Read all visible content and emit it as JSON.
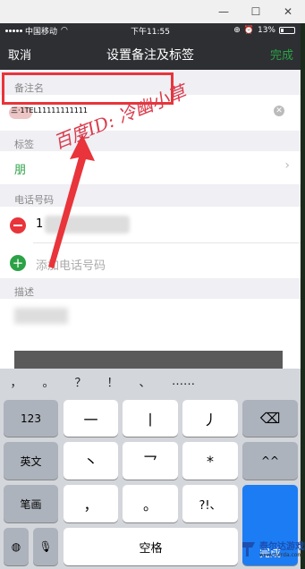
{
  "window": {
    "controls": [
      "—",
      "☐",
      "✕"
    ]
  },
  "status": {
    "carrier": "中国移动",
    "time": "下午11:55",
    "battery": "13%"
  },
  "nav": {
    "cancel": "取消",
    "title": "设置备注及标签",
    "done": "完成"
  },
  "remark": {
    "section_label": "备注名",
    "value": "三·1TEL11111111111"
  },
  "tags": {
    "section_label": "标签",
    "value": "朋"
  },
  "phone": {
    "section_label": "电话号码",
    "number": "1",
    "add_placeholder": "添加电话号码"
  },
  "description": {
    "section_label": "描述"
  },
  "watermark": "百度ID: 冷幽小草",
  "keyboard": {
    "candidates": [
      "，",
      "。",
      "？",
      "！",
      "、",
      "……"
    ],
    "row1": [
      "123",
      "一",
      "丨",
      "丿",
      "⌫"
    ],
    "row2": [
      "英文",
      "丶",
      "乛",
      "*",
      "^^"
    ],
    "row3": [
      "笔画",
      "，",
      "。",
      "?!、",
      "完成"
    ],
    "row4": [
      "globe",
      "mic",
      "空格"
    ]
  },
  "logo": "泰尔达游戏网",
  "logo_url": "www.tairda.com",
  "colors": {
    "accent": "#2ba245",
    "highlight": "#e8343a",
    "keyboard_action": "#1c7cf4"
  }
}
